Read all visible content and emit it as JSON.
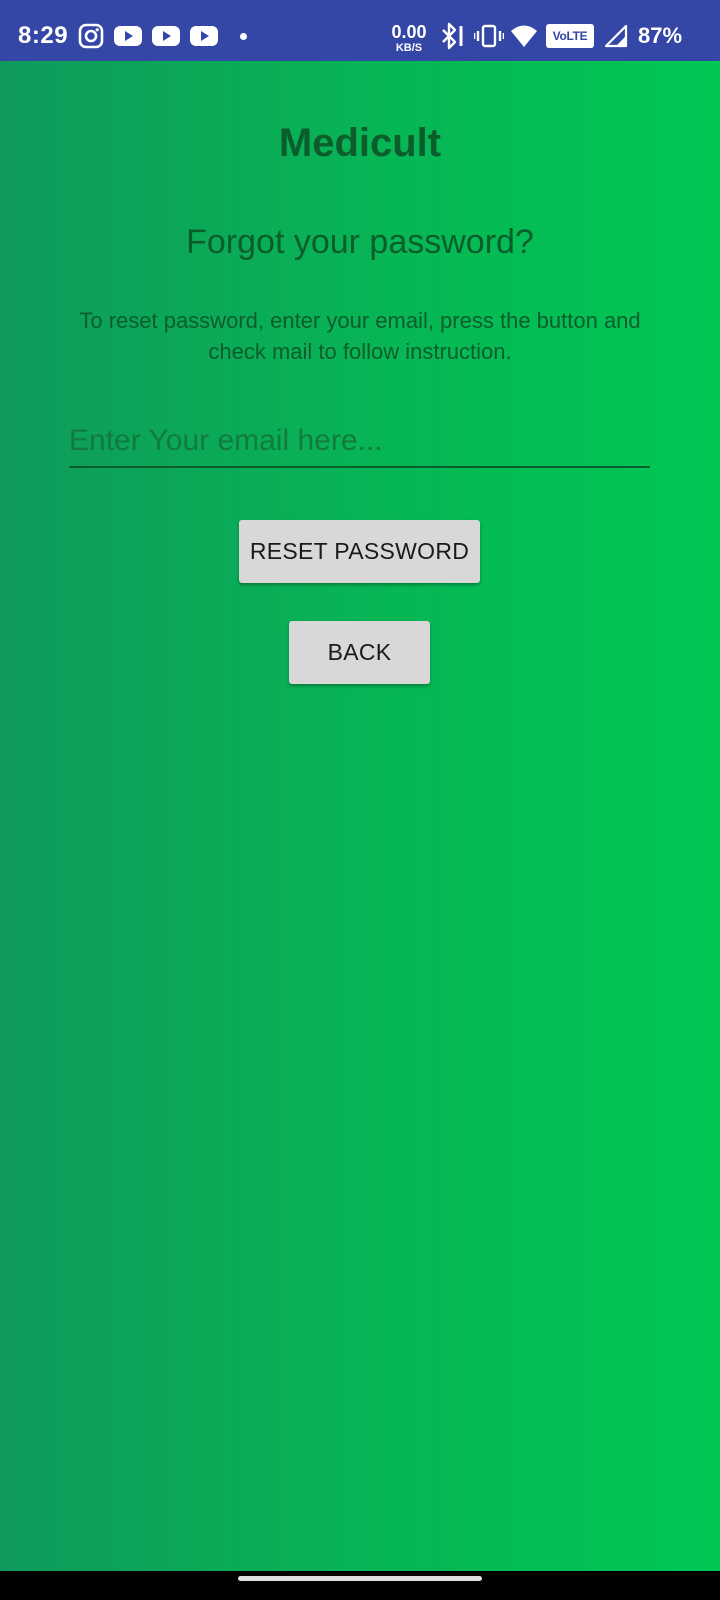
{
  "status_bar": {
    "time": "8:29",
    "notification_icons": [
      "instagram-icon",
      "youtube-icon",
      "youtube-icon",
      "youtube-icon"
    ],
    "network_speed_value": "0.00",
    "network_speed_unit": "KB/S",
    "volte_label": "VoLTE",
    "battery_percent": "87%",
    "background_color": "#3446a6"
  },
  "app": {
    "title": "Medicult",
    "heading": "Forgot your password?",
    "instruction": "To reset password, enter your email, press the button and check mail to follow instruction.",
    "email_input": {
      "value": "",
      "placeholder": "Enter Your email here..."
    },
    "reset_button_label": "RESET PASSWORD",
    "back_button_label": "BACK",
    "colors": {
      "gradient_start": "#0f9a5c",
      "gradient_end": "#00c853",
      "text": "#0b5d2c",
      "button_bg": "#d8d8d8"
    }
  }
}
